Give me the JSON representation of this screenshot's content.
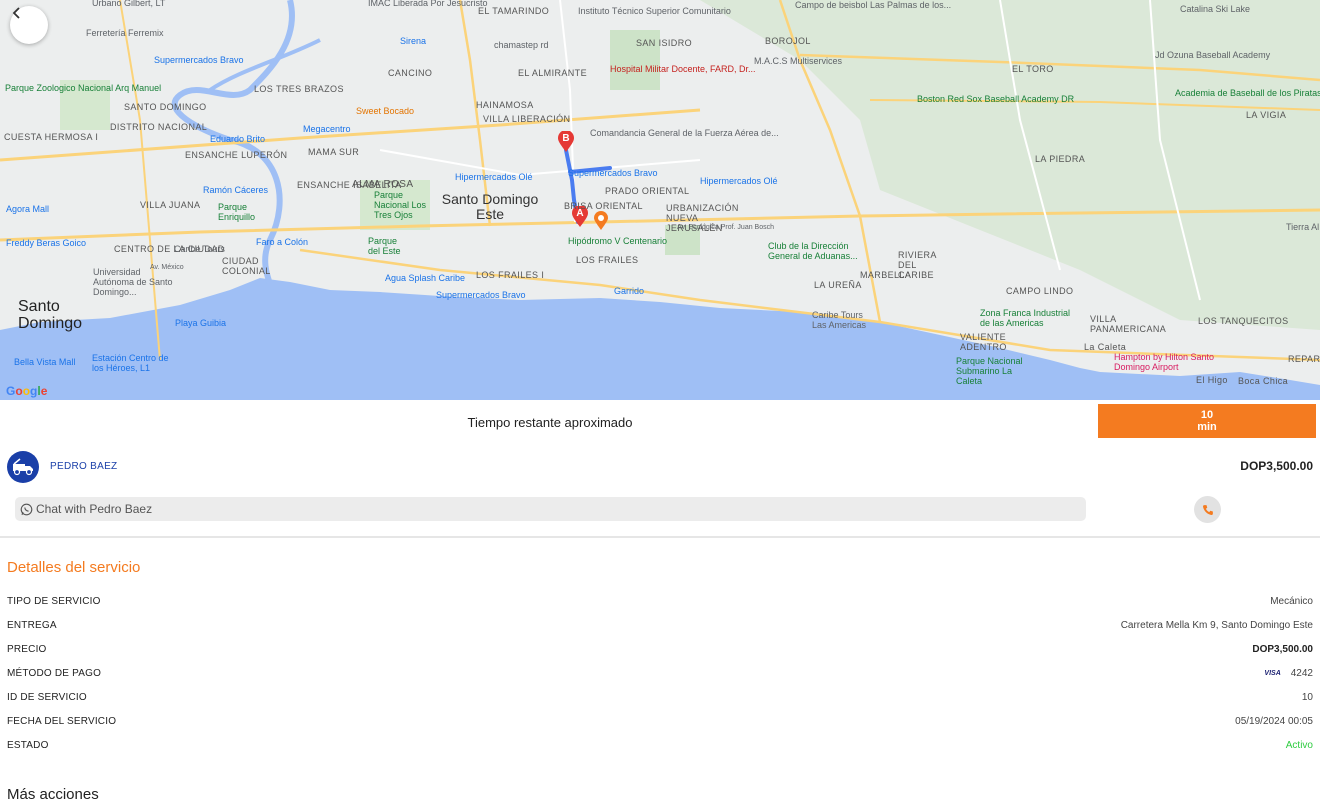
{
  "map": {
    "back_icon": "chevron-left-icon",
    "google_logo": "Google",
    "labels": {
      "urbano_gilbert": "Urbano Gilbert, LT",
      "imac": "IMAC Liberada Por Jesucristo",
      "el_tamarindo": "EL TAMARINDO",
      "instituto": "Instituto Técnico Superior Comunitario",
      "campo_beisbol": "Campo de beisbol Las Palmas de los...",
      "catalina": "Catalina Ski Lake",
      "ferreteria": "Ferretería Ferremix",
      "sirena": "Sirena",
      "chamastep": "chamastep rd",
      "san_isidro": "SAN ISIDRO",
      "borojol": "BOROJOL",
      "jd_ozuna": "Jd Ozuna Baseball Academy",
      "supermercados_bravo_1": "Supermercados Bravo",
      "cancino": "CANCINO",
      "el_almirante": "EL ALMIRANTE",
      "hospital": "Hospital Militar Docente, FARD, Dr...",
      "macs": "M.A.C.S Multiservices",
      "el_toro": "El Toro",
      "parque_zoologico": "Parque Zoologico Nacional Arq Manuel",
      "santo_domingo_n": "SANTO DOMINGO",
      "los_tres_brazos": "LOS TRES BRAZOS",
      "sweet_bocado": "Sweet Bocado",
      "hainamosa": "HAINAMOSA",
      "boston": "Boston Red Sox Baseball Academy DR",
      "academia": "Academia de Baseball de los Piratas de Pittsburgh",
      "distrito": "DISTRITO NACIONAL",
      "villa_liberacion": "VILLA LIBERACIÓN",
      "la_vigia": "La Vigia",
      "cuesta_hermosa": "CUESTA HERMOSA I",
      "eduardo_brito": "Eduardo Brito",
      "megacentro": "Megacentro",
      "comandancia": "Comandancia General de la Fuerza Aérea de...",
      "mama_sur": "MAMA SUR",
      "supermercados_bravo_2": "Supermercados Bravo",
      "la_piedra": "La Piedra",
      "ensanche_luperon": "ENSANCHE LUPERÓN",
      "ramon_caceres": "Ramón Cáceres",
      "alma_rosa": "ALMA ROSA",
      "ensanche_isabelita": "ENSANCHE ISABELITA",
      "hipermercados_ole_1": "Hipermercados Olé",
      "prado_oriental": "PRADO ORIENTAL",
      "hipermercados_ole_2": "Hipermercados Olé",
      "villa_juana": "VILLA JUANA",
      "parque_enriquillo": "Parque Enriquillo",
      "parque_nacional": "Parque Nacional Los Tres Ojos",
      "santo_domingo_este": "Santo Domingo Este",
      "brisa_oriental": "BRISA ORIENTAL",
      "urbanizacion": "URBANIZACIÓN NUEVA JERUSALÉN",
      "agora": "Agora Mall",
      "freddy": "Freddy Beras Goico",
      "centro_ciudad": "CENTRO DE LA CIUDAD",
      "faro": "Faro a Colón",
      "parque_del_este": "Parque del Este",
      "hipodromo": "Hipódromo V Centenario",
      "club_direccion": "Club de la Dirección General de Aduanas...",
      "riviera": "RIVIERA DEL CARIBE",
      "tierra": "Tierra Al",
      "caribe_tours_1": "Caribe Tours",
      "ciudad_colonial": "CIUDAD COLONIAL",
      "universidad": "Universidad Autónoma de Santo Domingo...",
      "agua_splash": "Agua Splash Caribe",
      "los_frailes_i": "LOS FRAILES I",
      "los_frailes": "LOS FRAILES",
      "marbella": "MARBELLA",
      "la_urena": "LA UREÑA",
      "campo_lindo": "CAMPO LINDO",
      "santo_domingo_big": "Santo Domingo",
      "supermercados_bravo_3": "Supermercados Bravo",
      "garrido": "Garrido",
      "zona_franca": "Zona Franca Industrial de las Americas",
      "villa_panamericana": "VILLA PANAMERICANA",
      "los_tanquecitos": "LOS TANQUECITOS",
      "playa_guibia": "Playa Guibia",
      "caribe_tours_2": "Caribe Tours Las Americas",
      "valiente_adentro": "VALIENTE ADENTRO",
      "la_caleta": "La Caleta",
      "hampton": "Hampton by Hilton Santo Domingo Airport",
      "bella_vista": "Bella Vista Mall",
      "estacion": "Estación Centro de los Héroes, L1",
      "parque_submarino": "Parque Nacional Submarino La Caleta",
      "el_higo": "El Higo",
      "boca_chica": "Boca Chica",
      "repart": "REPART",
      "av_ecologica": "Av. Ecológica Prof. Juan Bosch",
      "av_mexico": "Av. México"
    },
    "marker_a": "A",
    "marker_b": "B"
  },
  "eta": {
    "label": "Tiempo restante aproximado",
    "value": "10",
    "unit": "min",
    "color": "#f47b20"
  },
  "driver": {
    "name": "PEDRO BAEZ",
    "price": "DOP3,500.00",
    "avatar_icon": "tow-truck-icon",
    "avatar_color": "#1a3fa8"
  },
  "chat": {
    "icon": "whatsapp-icon",
    "label": "Chat with Pedro Baez"
  },
  "call": {
    "icon": "phone-icon"
  },
  "details": {
    "title": "Detalles del servicio",
    "rows": [
      {
        "key": "TIPO DE SERVICIO",
        "value": "Mecánico"
      },
      {
        "key": "ENTREGA",
        "value": "Carretera Mella Km 9, Santo Domingo Este"
      },
      {
        "key": "PRECIO",
        "value": "DOP3,500.00"
      },
      {
        "key": "MÉTODO DE PAGO",
        "value": "4242",
        "card_brand": "VISA"
      },
      {
        "key": "ID DE SERVICIO",
        "value": "10"
      },
      {
        "key": "FECHA DEL SERVICIO",
        "value": "05/19/2024 00:05"
      },
      {
        "key": "ESTADO",
        "value": "Activo",
        "status_color": "#2ecc40"
      }
    ]
  },
  "more_actions": {
    "title": "Más acciones"
  }
}
